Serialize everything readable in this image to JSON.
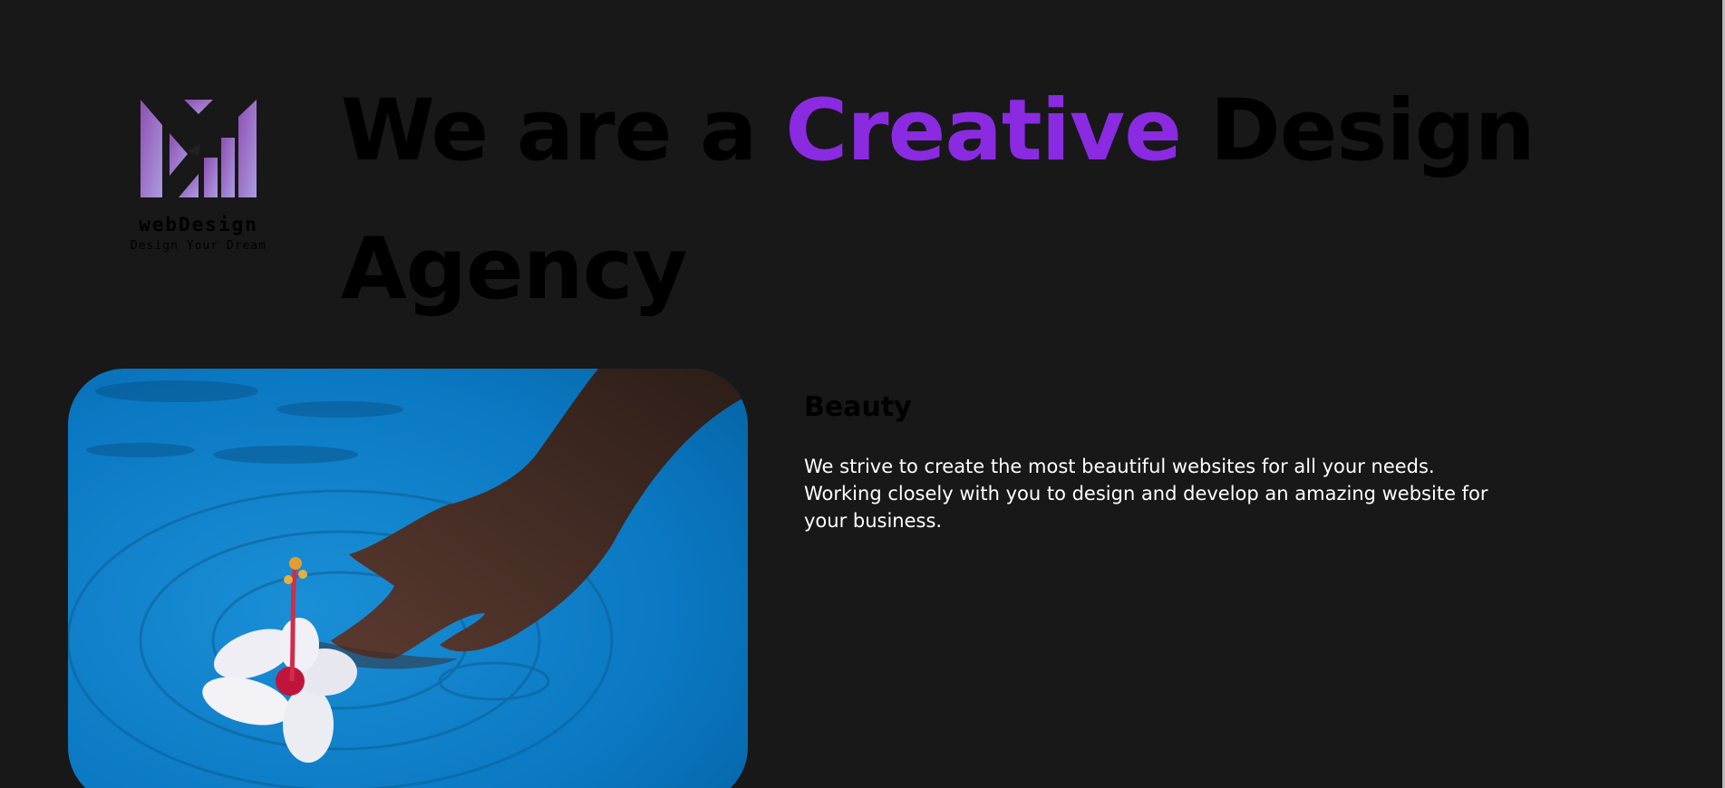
{
  "brand": {
    "name": "webDesign",
    "tagline": "Design Your Dream",
    "logo_icon": "monogram-m-logo",
    "gradient_colors": [
      "#8d55b3",
      "#a895dc"
    ]
  },
  "hero": {
    "headline_before": "We are a ",
    "headline_accent": "Creative",
    "headline_after": " Design",
    "headline_line2": "Agency",
    "accent_color": "#8a2be2",
    "image_icon": "hand-and-flower-in-water-photo"
  },
  "feature": {
    "title": "Beauty",
    "description": "We strive to create the most beautiful websites for all your needs. Working closely with you to design and develop an amazing website for your business."
  }
}
